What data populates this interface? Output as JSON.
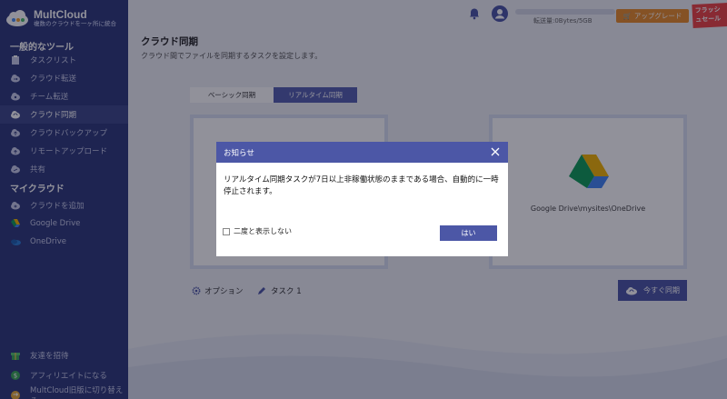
{
  "brand": {
    "name": "MultCloud",
    "tagline": "複数のクラウドを一ヶ所に統合"
  },
  "sidebar": {
    "sections": [
      {
        "title": "一般的なツール"
      },
      {
        "title": "マイクラウド"
      }
    ],
    "tools": [
      {
        "label": "タスクリスト",
        "icon": "clipboard-icon"
      },
      {
        "label": "クラウド転送",
        "icon": "cloud-transfer-icon"
      },
      {
        "label": "チーム転送",
        "icon": "team-transfer-icon"
      },
      {
        "label": "クラウド同期",
        "icon": "cloud-sync-icon",
        "active": true
      },
      {
        "label": "クラウドバックアップ",
        "icon": "cloud-backup-icon"
      },
      {
        "label": "リモートアップロード",
        "icon": "cloud-upload-icon"
      },
      {
        "label": "共有",
        "icon": "share-icon"
      }
    ],
    "clouds": [
      {
        "label": "クラウドを追加",
        "icon": "cloud-add-icon"
      },
      {
        "label": "Google Drive",
        "icon": "google-drive-icon"
      },
      {
        "label": "OneDrive",
        "icon": "onedrive-icon"
      }
    ],
    "footer": [
      {
        "label": "友達を招待",
        "icon": "gift-icon"
      },
      {
        "label": "アフィリエイトになる",
        "icon": "affiliate-icon"
      },
      {
        "label": "MultCloud旧版に切り替える",
        "icon": "switch-icon"
      }
    ]
  },
  "topbar": {
    "storage_text": "転送量:0Bytes/5GB",
    "storage_used_fraction": 0,
    "upgrade_label": "アップグレード",
    "flash_label": "フラッシュセール"
  },
  "main": {
    "title": "クラウド同期",
    "subtitle": "クラウド間でファイルを同期するタスクを設定します。",
    "tabs": [
      {
        "label": "ベーシック同期"
      },
      {
        "label": "リアルタイム同期",
        "selected": true
      }
    ],
    "target_path": "Google Drive\\mysites\\OneDrive",
    "option_label": "オプション",
    "task_label": "タスク 1",
    "sync_now_label": "今すぐ同期"
  },
  "dialog": {
    "title": "お知らせ",
    "message": "リアルタイム同期タスクが7日以上非稼働状態のままである場合、自動的に一時停止されます。",
    "dont_show_label": "二度と表示しない",
    "dont_show_checked": false,
    "ok_label": "はい"
  },
  "colors": {
    "sidebar_bg": "#2f3a7a",
    "accent": "#4c57a6",
    "upgrade": "#e98d2a"
  }
}
